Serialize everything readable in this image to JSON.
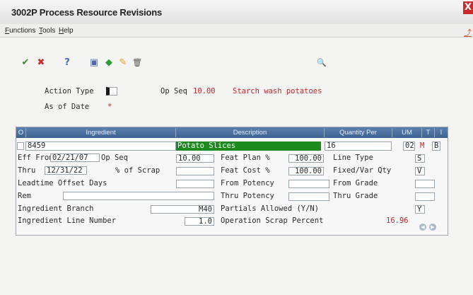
{
  "window": {
    "title": "3002P   Process Resource Revisions",
    "close_glyph": "X"
  },
  "menu": {
    "functions": "Functions",
    "tools": "Tools",
    "help": "Help"
  },
  "toolbar": {
    "ok": "✔",
    "cancel": "✖",
    "help": "?",
    "table": "▣",
    "forward": "◆",
    "edit": "✎",
    "delete": "🗑",
    "find": "🔍"
  },
  "header": {
    "action_type_label": "Action Type",
    "action_type_value": "",
    "as_of_date_label": "As of Date",
    "as_of_date_marker": "*",
    "op_seq_label": "Op Seq",
    "op_seq_value": "10.00",
    "op_description": "Starch wash potatoes"
  },
  "grid": {
    "columns": [
      "O",
      "Ingredient",
      "Description",
      "Quantity Per",
      "UM",
      "T",
      "I"
    ],
    "row": {
      "ingredient": "8459",
      "description": "Potato Slices",
      "quantity_per": "16",
      "um": "02",
      "t": "M",
      "i": "B"
    }
  },
  "detail": {
    "eff_from_label": "Eff From",
    "eff_from_value": "02/21/07",
    "op_seq_label": "Op Seq",
    "op_seq_value": "10.00",
    "thru_label": "Thru",
    "thru_value": "12/31/22",
    "scrap_label": "% of Scrap",
    "scrap_value": "",
    "leadtime_label": "Leadtime Offset Days",
    "leadtime_value": "",
    "rem_label": "Rem",
    "rem_value": "",
    "branch_label": "Ingredient Branch",
    "branch_value": "M40",
    "line_number_label": "Ingredient Line Number",
    "line_number_value": "1.0",
    "feat_plan_label": "Feat Plan %",
    "feat_plan_value": "100.00",
    "feat_cost_label": "Feat Cost %",
    "feat_cost_value": "100.00",
    "from_potency_label": "From Potency",
    "from_potency_value": "",
    "thru_potency_label": "Thru Potency",
    "thru_potency_value": "",
    "partials_label": "Partials Allowed (Y/N)",
    "partials_value": "Y",
    "op_scrap_label": "Operation Scrap Percent",
    "op_scrap_value": "16.96",
    "line_type_label": "Line Type",
    "line_type_value": "S",
    "fixed_var_label": "Fixed/Var Qty",
    "fixed_var_value": "V",
    "from_grade_label": "From Grade",
    "from_grade_value": "",
    "thru_grade_label": "Thru Grade",
    "thru_grade_value": ""
  },
  "pager": {
    "prev": "◀",
    "next": "▶"
  }
}
